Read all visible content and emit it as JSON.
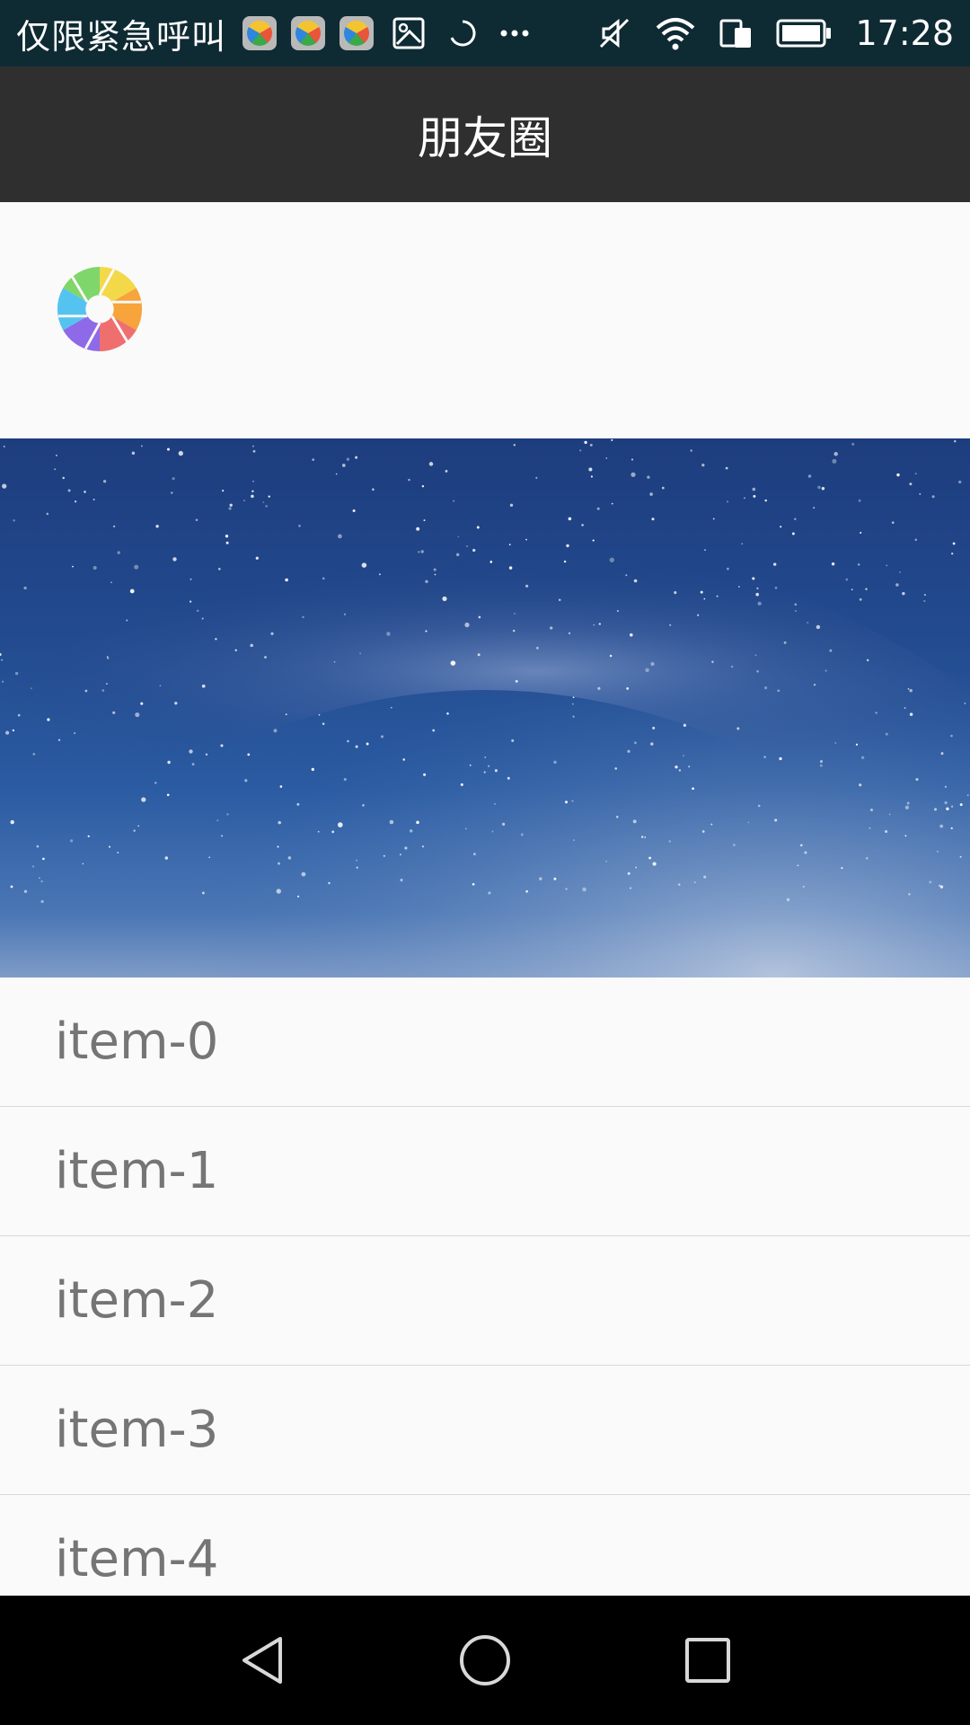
{
  "status_bar": {
    "emergency_text": "仅限紧急呼叫",
    "time": "17:28",
    "icons": [
      "app-notification-icon",
      "app-notification-icon",
      "app-notification-icon",
      "image-icon",
      "sync-icon",
      "more-icon",
      "mute-icon",
      "wifi-icon",
      "dual-sim-icon",
      "battery-icon"
    ]
  },
  "header": {
    "title": "朋友圈"
  },
  "list": {
    "items": [
      "item-0",
      "item-1",
      "item-2",
      "item-3",
      "item-4"
    ]
  },
  "colors": {
    "status_bar_bg": "#0e2a33",
    "title_bar_bg": "#2f2f2f",
    "page_bg": "#fafafa",
    "item_text": "#757575",
    "nav_bar_bg": "#000000"
  }
}
